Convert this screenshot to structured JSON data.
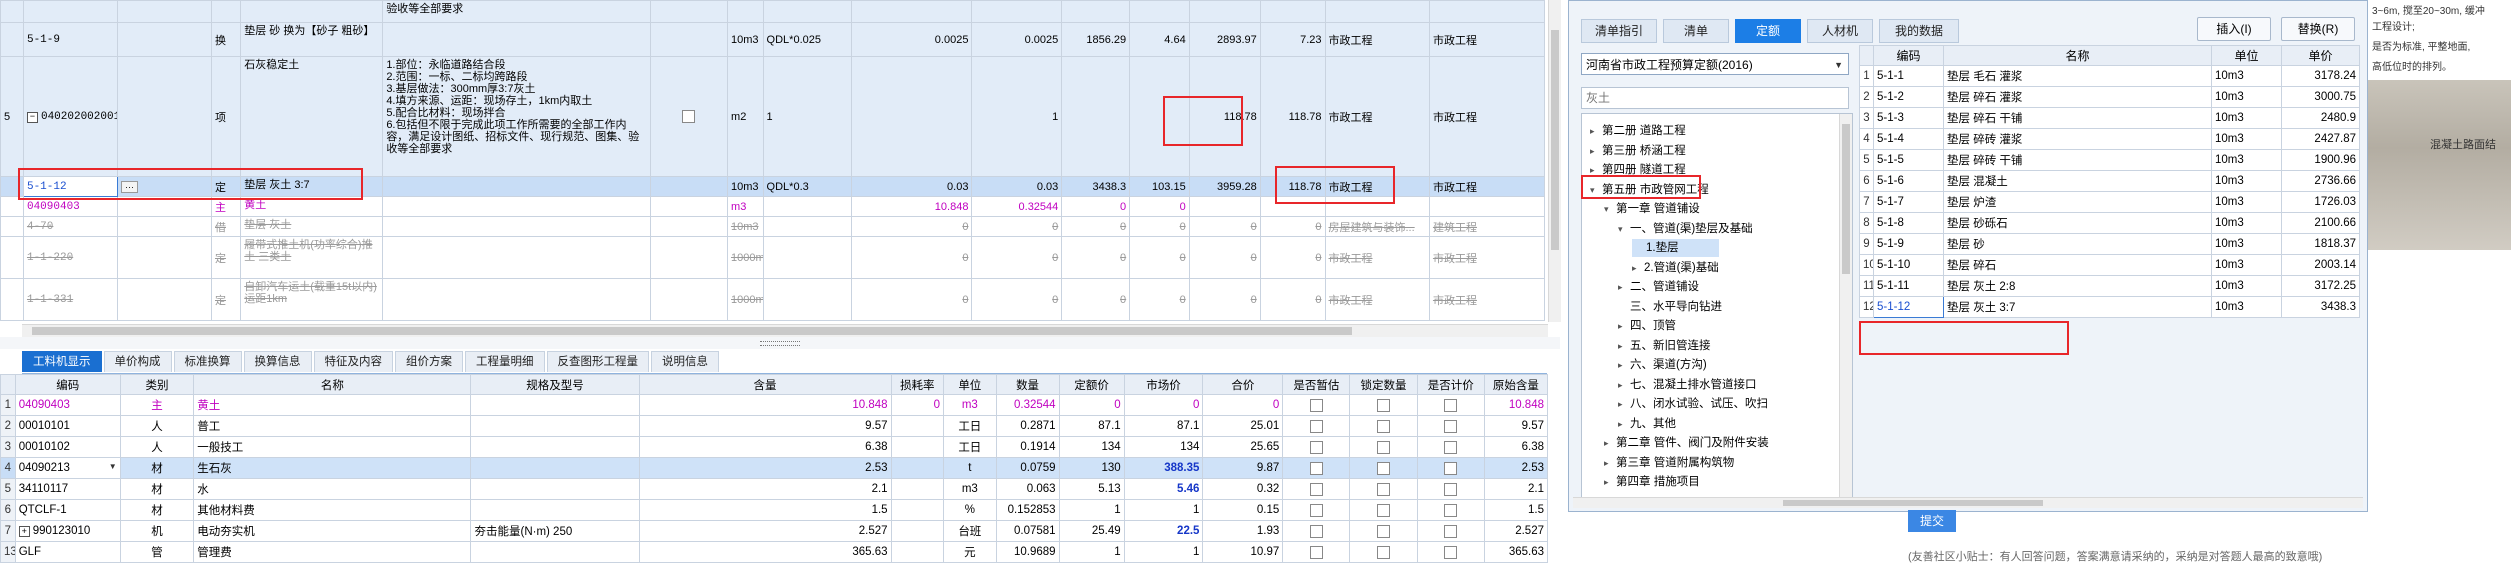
{
  "top_rows": [
    {
      "idx": "",
      "code": "",
      "type": "",
      "name": "",
      "desc": "验收等全部要求",
      "unit": "",
      "qty_expr": "",
      "qty": "",
      "qty2": "",
      "price": "",
      "unit_price": "",
      "total": "",
      "composite": "",
      "spec": "",
      "col2": ""
    },
    {
      "idx": "",
      "code": "5-1-9",
      "type": "换",
      "name": "垫层 砂  换为【砂子 粗砂】",
      "desc": "",
      "unit": "10m3",
      "qty_expr": "QDL*0.025",
      "qty": "0.0025",
      "qty2": "0.0025",
      "price": "1856.29",
      "unit_price": "4.64",
      "total": "2893.97",
      "composite": "7.23",
      "spec": "市政工程",
      "col2": "市政工程"
    },
    {
      "idx": "5",
      "code": "040202002001",
      "type": "项",
      "name": "石灰稳定土",
      "desc": "1.部位：永临道路结合段\n2.范围：一标、二标均跨路段\n3.基层做法：300mm厚3:7灰土\n4.填方来源、运距：现场存土，1km内取土\n5.配合比材料：现场拌合\n6.包括但不限于完成此项工作所需要的全部工作内容，满足设计图纸、招标文件、现行规范、图集、验收等全部要求",
      "unit": "m2",
      "qty_expr": "1",
      "qty": "",
      "qty2": "1",
      "price": "",
      "unit_price": "",
      "total": "118.78",
      "composite": "118.78",
      "spec": "市政工程",
      "col2": "市政工程"
    },
    {
      "idx": "",
      "code": "5-1-12",
      "type": "定",
      "name": "垫层 灰土 3:7",
      "desc": "",
      "unit": "10m3",
      "qty_expr": "QDL*0.3",
      "qty": "0.03",
      "qty2": "0.03",
      "price": "3438.3",
      "unit_price": "103.15",
      "total": "3959.28",
      "composite": "118.78",
      "spec": "市政工程",
      "col2": "市政工程"
    },
    {
      "idx": "",
      "code": "04090403",
      "type": "主",
      "name": "黄土",
      "desc": "",
      "unit": "m3",
      "qty_expr": "",
      "qty": "10.848",
      "qty2": "0.32544",
      "price": "0",
      "unit_price": "0",
      "total": "",
      "composite": "",
      "spec": "",
      "col2": ""
    },
    {
      "idx": "",
      "code": "4-70",
      "type": "借",
      "name": "垫层 灰土",
      "desc": "",
      "unit": "10m3",
      "qty_expr": "",
      "qty": "0",
      "qty2": "0",
      "price": "0",
      "unit_price": "0",
      "total": "0",
      "composite": "0",
      "spec": "房屋建筑与装饰...",
      "col2": "建筑工程"
    },
    {
      "idx": "",
      "code": "1-1-220",
      "type": "定",
      "name": "履带式推土机(功率综合)推土 三类土",
      "desc": "",
      "unit": "1000m3",
      "qty_expr": "",
      "qty": "0",
      "qty2": "0",
      "price": "0",
      "unit_price": "0",
      "total": "0",
      "composite": "0",
      "spec": "市政工程",
      "col2": "市政工程"
    },
    {
      "idx": "",
      "code": "1-1-331",
      "type": "定",
      "name": "自卸汽车运土(载重15t以内) 运距1km",
      "desc": "",
      "unit": "1000m3",
      "qty_expr": "",
      "qty": "0",
      "qty2": "0",
      "price": "0",
      "unit_price": "0",
      "total": "0",
      "composite": "0",
      "spec": "市政工程",
      "col2": "市政工程"
    }
  ],
  "bottom_tabs": [
    "工料机显示",
    "单价构成",
    "标准换算",
    "换算信息",
    "特征及内容",
    "组价方案",
    "工程量明细",
    "反查图形工程量",
    "说明信息"
  ],
  "bottom_headers": [
    "",
    "编码",
    "类别",
    "名称",
    "规格及型号",
    "含量",
    "损耗率",
    "单位",
    "数量",
    "定额价",
    "市场价",
    "合价",
    "是否暂估",
    "锁定数量",
    "是否计价",
    "原始含量"
  ],
  "bottom_rows": [
    {
      "n": "1",
      "code": "04090403",
      "cat": "主",
      "name": "黄土",
      "spec": "",
      "content": "10.848",
      "loss": "0",
      "unit": "m3",
      "qty": "0.32544",
      "price": "0",
      "market": "0",
      "total": "0",
      "orig": "10.848",
      "style": "pink"
    },
    {
      "n": "2",
      "code": "00010101",
      "cat": "人",
      "name": "普工",
      "spec": "",
      "content": "9.57",
      "loss": "",
      "unit": "工日",
      "qty": "0.2871",
      "price": "87.1",
      "market": "87.1",
      "total": "25.01",
      "orig": "9.57",
      "style": ""
    },
    {
      "n": "3",
      "code": "00010102",
      "cat": "人",
      "name": "一般技工",
      "spec": "",
      "content": "6.38",
      "loss": "",
      "unit": "工日",
      "qty": "0.1914",
      "price": "134",
      "market": "134",
      "total": "25.65",
      "orig": "6.38",
      "style": ""
    },
    {
      "n": "4",
      "code": "04090213",
      "cat": "材",
      "name": "生石灰",
      "spec": "",
      "content": "2.53",
      "loss": "",
      "unit": "t",
      "qty": "0.0759",
      "price": "130",
      "market": "388.35",
      "total": "9.87",
      "orig": "2.53",
      "style": "sel"
    },
    {
      "n": "5",
      "code": "34110117",
      "cat": "材",
      "name": "水",
      "spec": "",
      "content": "2.1",
      "loss": "",
      "unit": "m3",
      "qty": "0.063",
      "price": "5.13",
      "market": "5.46",
      "total": "0.32",
      "orig": "2.1",
      "style": ""
    },
    {
      "n": "6",
      "code": "QTCLF-1",
      "cat": "材",
      "name": "其他材料费",
      "spec": "",
      "content": "1.5",
      "loss": "",
      "unit": "%",
      "qty": "0.152853",
      "price": "1",
      "market": "1",
      "total": "0.15",
      "orig": "1.5",
      "style": ""
    },
    {
      "n": "7",
      "code": "990123010",
      "cat": "机",
      "name": "电动夯实机",
      "spec": "夯击能量(N·m) 250",
      "content": "2.527",
      "loss": "",
      "unit": "台班",
      "qty": "0.07581",
      "price": "25.49",
      "market": "22.5",
      "total": "1.93",
      "orig": "2.527",
      "style": ""
    },
    {
      "n": "13",
      "code": "GLF",
      "cat": "管",
      "name": "管理费",
      "spec": "",
      "content": "365.63",
      "loss": "",
      "unit": "元",
      "qty": "10.9689",
      "price": "1",
      "market": "1",
      "total": "10.97",
      "orig": "365.63",
      "style": ""
    }
  ],
  "dialog": {
    "tabs": [
      "清单指引",
      "清单",
      "定额",
      "人材机",
      "我的数据"
    ],
    "insert_btn": "插入(I)",
    "replace_btn": "替换(R)",
    "library": "河南省市政工程预算定额(2016)",
    "search_placeholder": "灰土",
    "tree": [
      {
        "label": "第二册 道路工程",
        "level": 0,
        "arrow": "▸"
      },
      {
        "label": "第三册 桥涵工程",
        "level": 0,
        "arrow": "▸"
      },
      {
        "label": "第四册 隧道工程",
        "level": 0,
        "arrow": "▸"
      },
      {
        "label": "第五册 市政管网工程",
        "level": 0,
        "arrow": "▾"
      },
      {
        "label": "第一章 管道铺设",
        "level": 1,
        "arrow": "▾"
      },
      {
        "label": "一、管道(渠)垫层及基础",
        "level": 2,
        "arrow": "▾"
      },
      {
        "label": "1.垫层",
        "level": 3,
        "arrow": "",
        "selected": true
      },
      {
        "label": "2.管道(渠)基础",
        "level": 3,
        "arrow": "▸"
      },
      {
        "label": "二、管道铺设",
        "level": 2,
        "arrow": "▸"
      },
      {
        "label": "三、水平导向钻进",
        "level": 2,
        "arrow": ""
      },
      {
        "label": "四、顶管",
        "level": 2,
        "arrow": "▸"
      },
      {
        "label": "五、新旧管连接",
        "level": 2,
        "arrow": "▸"
      },
      {
        "label": "六、渠道(方沟)",
        "level": 2,
        "arrow": "▸"
      },
      {
        "label": "七、混凝土排水管道接口",
        "level": 2,
        "arrow": "▸"
      },
      {
        "label": "八、闭水试验、试压、吹扫",
        "level": 2,
        "arrow": "▸"
      },
      {
        "label": "九、其他",
        "level": 2,
        "arrow": "▸"
      },
      {
        "label": "第二章 管件、阀门及附件安装",
        "level": 1,
        "arrow": "▸"
      },
      {
        "label": "第三章 管道附属构筑物",
        "level": 1,
        "arrow": "▸"
      },
      {
        "label": "第四章 措施项目",
        "level": 1,
        "arrow": "▸"
      }
    ],
    "headers": [
      "",
      "编码",
      "名称",
      "单位",
      "单价"
    ],
    "rows": [
      {
        "n": "1",
        "code": "5-1-1",
        "name": "垫层 毛石 灌浆",
        "unit": "10m3",
        "price": "3178.24"
      },
      {
        "n": "2",
        "code": "5-1-2",
        "name": "垫层 碎石 灌浆",
        "unit": "10m3",
        "price": "3000.75"
      },
      {
        "n": "3",
        "code": "5-1-3",
        "name": "垫层 碎石 干铺",
        "unit": "10m3",
        "price": "2480.9"
      },
      {
        "n": "4",
        "code": "5-1-4",
        "name": "垫层 碎砖 灌浆",
        "unit": "10m3",
        "price": "2427.87"
      },
      {
        "n": "5",
        "code": "5-1-5",
        "name": "垫层 碎砖 干铺",
        "unit": "10m3",
        "price": "1900.96"
      },
      {
        "n": "6",
        "code": "5-1-6",
        "name": "垫层 混凝土",
        "unit": "10m3",
        "price": "2736.66"
      },
      {
        "n": "7",
        "code": "5-1-7",
        "name": "垫层 炉渣",
        "unit": "10m3",
        "price": "1726.03"
      },
      {
        "n": "8",
        "code": "5-1-8",
        "name": "垫层 砂砾石",
        "unit": "10m3",
        "price": "2100.66"
      },
      {
        "n": "9",
        "code": "5-1-9",
        "name": "垫层 砂",
        "unit": "10m3",
        "price": "1818.37"
      },
      {
        "n": "10",
        "code": "5-1-10",
        "name": "垫层 碎石",
        "unit": "10m3",
        "price": "2003.14"
      },
      {
        "n": "11",
        "code": "5-1-11",
        "name": "垫层 灰土 2:8",
        "unit": "10m3",
        "price": "3172.25"
      },
      {
        "n": "12",
        "code": "5-1-12",
        "name": "垫层 灰土 3:7",
        "unit": "10m3",
        "price": "3438.3"
      }
    ]
  },
  "background_page": {
    "top_text": "3~6m, 搅至20~30m, 缓冲",
    "side_lines": [
      "工程设计;",
      "是否为标准, 平整地面,",
      "高低位时的排列。"
    ],
    "tag": "混凝土路面结",
    "submit_btn": "提交",
    "tip": "(友善社区小贴士：有人回答问题，答案满意请采纳的，采纳是对答题人最高的致意哦)"
  }
}
